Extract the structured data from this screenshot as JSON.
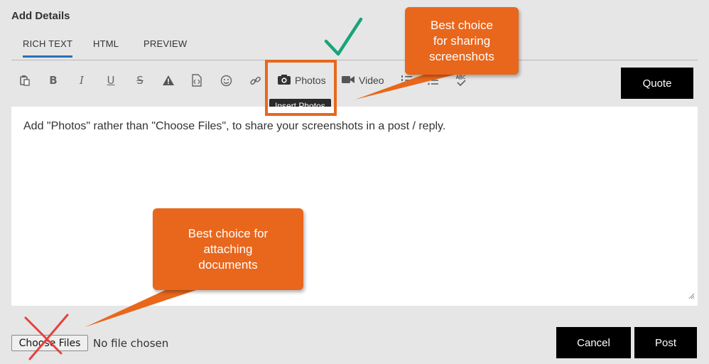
{
  "header": {
    "title": "Add Details"
  },
  "tabs": [
    {
      "label": "RICH TEXT",
      "active": true
    },
    {
      "label": "HTML",
      "active": false
    },
    {
      "label": "PREVIEW",
      "active": false
    }
  ],
  "toolbar": {
    "icons": [
      "clipboard-icon",
      "bold-icon",
      "italic-icon",
      "underline-icon",
      "strikethrough-icon",
      "warning-icon",
      "code-icon",
      "emoji-icon",
      "link-icon"
    ],
    "photos_label": "Photos",
    "photos_tooltip": "Insert Photos",
    "video_label": "Video",
    "quote_label": "Quote"
  },
  "editor": {
    "text": "Add \"Photos\" rather than \"Choose Files\", to share your screenshots in a post / reply."
  },
  "attachment": {
    "button_label": "Choose Files",
    "status": "No file chosen"
  },
  "actions": {
    "cancel_label": "Cancel",
    "post_label": "Post"
  },
  "annotations": {
    "top_callout": [
      "Best choice",
      "for sharing",
      "screenshots"
    ],
    "bottom_callout": [
      "Best choice for",
      "attaching",
      "documents"
    ],
    "accent_color": "#e8671c",
    "check_color": "#1aa37a",
    "cross_color": "#e8413c"
  }
}
